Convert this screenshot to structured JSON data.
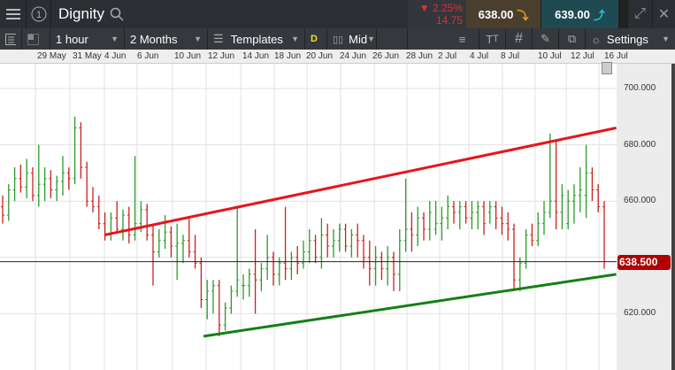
{
  "header": {
    "instrument": "Dignity",
    "change_pct": "2.25%",
    "change_abs": "14.75",
    "sell_price": "638.00",
    "buy_price": "639.00",
    "colors": {
      "down": "#e0303a",
      "sell_bg": "#4a3f2e",
      "buy_bg": "#1f4a52"
    }
  },
  "toolbar": {
    "interval": "1 hour",
    "range": "2 Months",
    "templates": "Templates",
    "d_badge": "D",
    "price_type": "Mid",
    "settings": "Settings"
  },
  "time_axis": [
    "29 May",
    "31 May",
    "4 Jun",
    "6 Jun",
    "10 Jun",
    "12 Jun",
    "14 Jun",
    "18 Jun",
    "20 Jun",
    "24 Jun",
    "26 Jun",
    "28 Jun",
    "2 Jul",
    "4 Jul",
    "8 Jul",
    "10 Jul",
    "12 Jul",
    "16 Jul"
  ],
  "chart_data": {
    "type": "ohlc",
    "y_ticks": [
      "700.000",
      "680.000",
      "660.000",
      "620.000"
    ],
    "ylim": [
      608,
      708
    ],
    "current_price": "638.500",
    "colors": {
      "up": "#2a9a2a",
      "down": "#cc1f1f",
      "resistance": "#e8141b",
      "support": "#138013"
    },
    "bars": [
      [
        658,
        662,
        652,
        655
      ],
      [
        655,
        666,
        653,
        664
      ],
      [
        664,
        672,
        660,
        668
      ],
      [
        668,
        673,
        663,
        665
      ],
      [
        665,
        675,
        661,
        670
      ],
      [
        670,
        672,
        660,
        662
      ],
      [
        662,
        680,
        658,
        666
      ],
      [
        666,
        672,
        660,
        668
      ],
      [
        668,
        671,
        661,
        664
      ],
      [
        664,
        669,
        660,
        667
      ],
      [
        667,
        676,
        662,
        670
      ],
      [
        670,
        672,
        664,
        668
      ],
      [
        668,
        690,
        666,
        686
      ],
      [
        686,
        688,
        668,
        672
      ],
      [
        672,
        674,
        658,
        660
      ],
      [
        660,
        665,
        656,
        658
      ],
      [
        658,
        662,
        650,
        652
      ],
      [
        652,
        656,
        646,
        648
      ],
      [
        648,
        656,
        646,
        654
      ],
      [
        654,
        660,
        649,
        650
      ],
      [
        650,
        657,
        646,
        655
      ],
      [
        655,
        658,
        645,
        648
      ],
      [
        648,
        676,
        646,
        652
      ],
      [
        652,
        660,
        649,
        657
      ],
      [
        657,
        659,
        646,
        648
      ],
      [
        648,
        652,
        630,
        642
      ],
      [
        642,
        650,
        640,
        646
      ],
      [
        646,
        655,
        643,
        649
      ],
      [
        649,
        651,
        640,
        644
      ],
      [
        644,
        652,
        632,
        645
      ],
      [
        645,
        648,
        638,
        646
      ],
      [
        646,
        654,
        640,
        642
      ],
      [
        642,
        648,
        636,
        638
      ],
      [
        638,
        640,
        622,
        625
      ],
      [
        625,
        632,
        618,
        628
      ],
      [
        628,
        632,
        620,
        630
      ],
      [
        630,
        632,
        612,
        616
      ],
      [
        616,
        624,
        614,
        622
      ],
      [
        622,
        630,
        620,
        628
      ],
      [
        628,
        658,
        626,
        632
      ],
      [
        630,
        634,
        625,
        630
      ],
      [
        630,
        636,
        626,
        634
      ],
      [
        634,
        650,
        620,
        632
      ],
      [
        632,
        638,
        628,
        636
      ],
      [
        636,
        648,
        632,
        640
      ],
      [
        640,
        642,
        630,
        634
      ],
      [
        634,
        640,
        630,
        638
      ],
      [
        638,
        658,
        632,
        636
      ],
      [
        636,
        642,
        632,
        640
      ],
      [
        640,
        644,
        634,
        638
      ],
      [
        638,
        646,
        636,
        642
      ],
      [
        642,
        650,
        638,
        646
      ],
      [
        646,
        648,
        638,
        640
      ],
      [
        640,
        654,
        636,
        648
      ],
      [
        648,
        652,
        640,
        644
      ],
      [
        644,
        650,
        640,
        646
      ],
      [
        646,
        652,
        642,
        650
      ],
      [
        650,
        652,
        642,
        644
      ],
      [
        644,
        650,
        640,
        648
      ],
      [
        648,
        652,
        640,
        646
      ],
      [
        646,
        648,
        636,
        640
      ],
      [
        640,
        646,
        630,
        636
      ],
      [
        636,
        644,
        630,
        640
      ],
      [
        640,
        642,
        632,
        636
      ],
      [
        636,
        644,
        630,
        640
      ],
      [
        640,
        642,
        628,
        634
      ],
      [
        634,
        650,
        628,
        646
      ],
      [
        646,
        668,
        642,
        650
      ],
      [
        650,
        656,
        642,
        648
      ],
      [
        648,
        658,
        644,
        654
      ],
      [
        654,
        656,
        646,
        650
      ],
      [
        650,
        660,
        646,
        656
      ],
      [
        650,
        660,
        648,
        652
      ],
      [
        652,
        658,
        646,
        654
      ],
      [
        654,
        662,
        650,
        658
      ],
      [
        658,
        660,
        652,
        656
      ],
      [
        656,
        660,
        650,
        658
      ],
      [
        658,
        660,
        652,
        654
      ],
      [
        654,
        660,
        650,
        656
      ],
      [
        656,
        660,
        650,
        658
      ],
      [
        658,
        660,
        648,
        652
      ],
      [
        656,
        660,
        652,
        658
      ],
      [
        658,
        660,
        650,
        654
      ],
      [
        654,
        658,
        648,
        652
      ],
      [
        652,
        656,
        646,
        650
      ],
      [
        650,
        652,
        628,
        632
      ],
      [
        632,
        640,
        628,
        638
      ],
      [
        638,
        650,
        636,
        648
      ],
      [
        648,
        652,
        644,
        646
      ],
      [
        646,
        656,
        644,
        652
      ],
      [
        652,
        660,
        648,
        656
      ],
      [
        656,
        684,
        654,
        660
      ],
      [
        660,
        682,
        650,
        656
      ],
      [
        656,
        666,
        650,
        662
      ],
      [
        652,
        664,
        650,
        660
      ],
      [
        660,
        666,
        652,
        662
      ],
      [
        662,
        672,
        656,
        664
      ],
      [
        662,
        680,
        654,
        670
      ],
      [
        670,
        672,
        660,
        664
      ],
      [
        664,
        666,
        656,
        658
      ],
      [
        658,
        660,
        636,
        638.5
      ]
    ],
    "trendlines": [
      {
        "kind": "resistance",
        "from": [
          17,
          648
        ],
        "to": [
          102,
          686
        ]
      },
      {
        "kind": "support",
        "from": [
          33.4,
          612
        ],
        "to": [
          102,
          634
        ]
      }
    ]
  }
}
